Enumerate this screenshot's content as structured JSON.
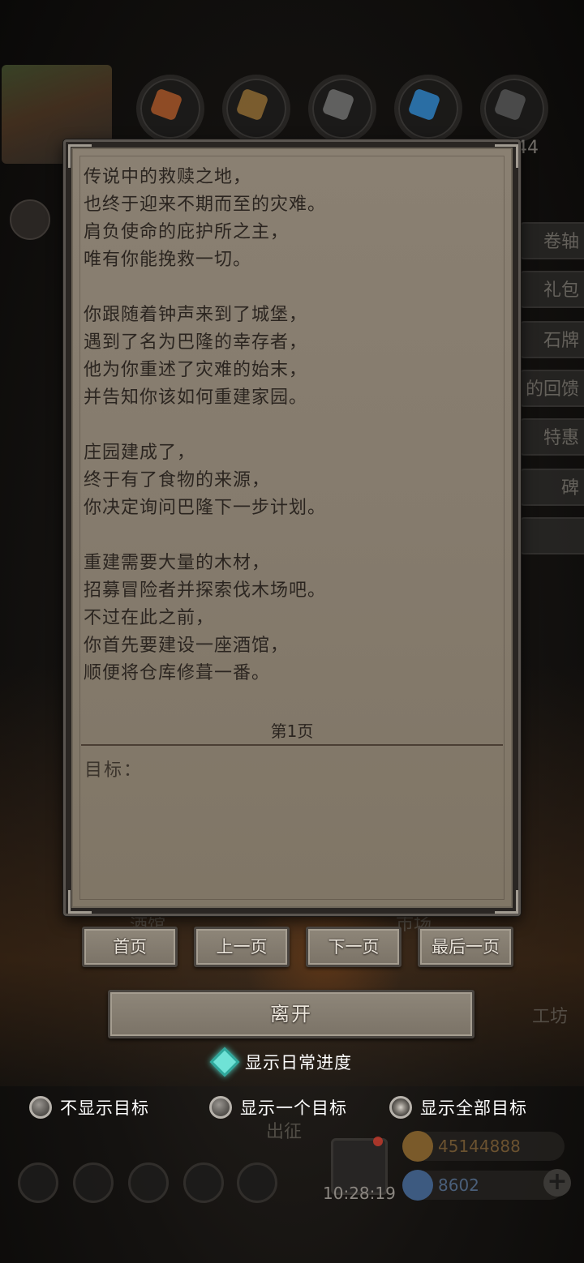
{
  "background": {
    "resource_right_value": "44",
    "side_buttons": [
      "卷轴",
      "礼包",
      "石牌",
      "的回馈",
      "特惠",
      "碑"
    ],
    "labels": {
      "tavern": "酒馆",
      "market": "市场",
      "workshop": "工坊",
      "expedition": "出征"
    },
    "clock": "10:28:19",
    "currencies": [
      {
        "value": "45144888",
        "color": "#7a5a2a",
        "icon": "gold-coin-icon"
      },
      {
        "value": "8602",
        "color": "#3d5a80",
        "icon": "blue-gem-icon"
      }
    ]
  },
  "dialog": {
    "story_paragraphs": [
      [
        "传说中的救赎之地，",
        "也终于迎来不期而至的灾难。",
        "肩负使命的庇护所之主，",
        "唯有你能挽救一切。"
      ],
      [
        "你跟随着钟声来到了城堡，",
        "遇到了名为巴隆的幸存者，",
        "他为你重述了灾难的始末，",
        "并告知你该如何重建家园。"
      ],
      [
        "庄园建成了，",
        "终于有了食物的来源，",
        "你决定询问巴隆下一步计划。"
      ],
      [
        "重建需要大量的木材，",
        "招募冒险者并探索伐木场吧。",
        "不过在此之前，",
        "你首先要建设一座酒馆，",
        "顺便将仓库修葺一番。"
      ]
    ],
    "page_label": "第1页",
    "goal_label": "目标："
  },
  "buttons": {
    "first_page": "首页",
    "prev_page": "上一页",
    "next_page": "下一页",
    "last_page": "最后一页",
    "leave": "离开"
  },
  "options": {
    "daily_progress": "显示日常进度",
    "hide_goals": "不显示目标",
    "show_one_goal": "显示一个目标",
    "show_all_goals": "显示全部目标",
    "selected": "show_all_goals"
  }
}
